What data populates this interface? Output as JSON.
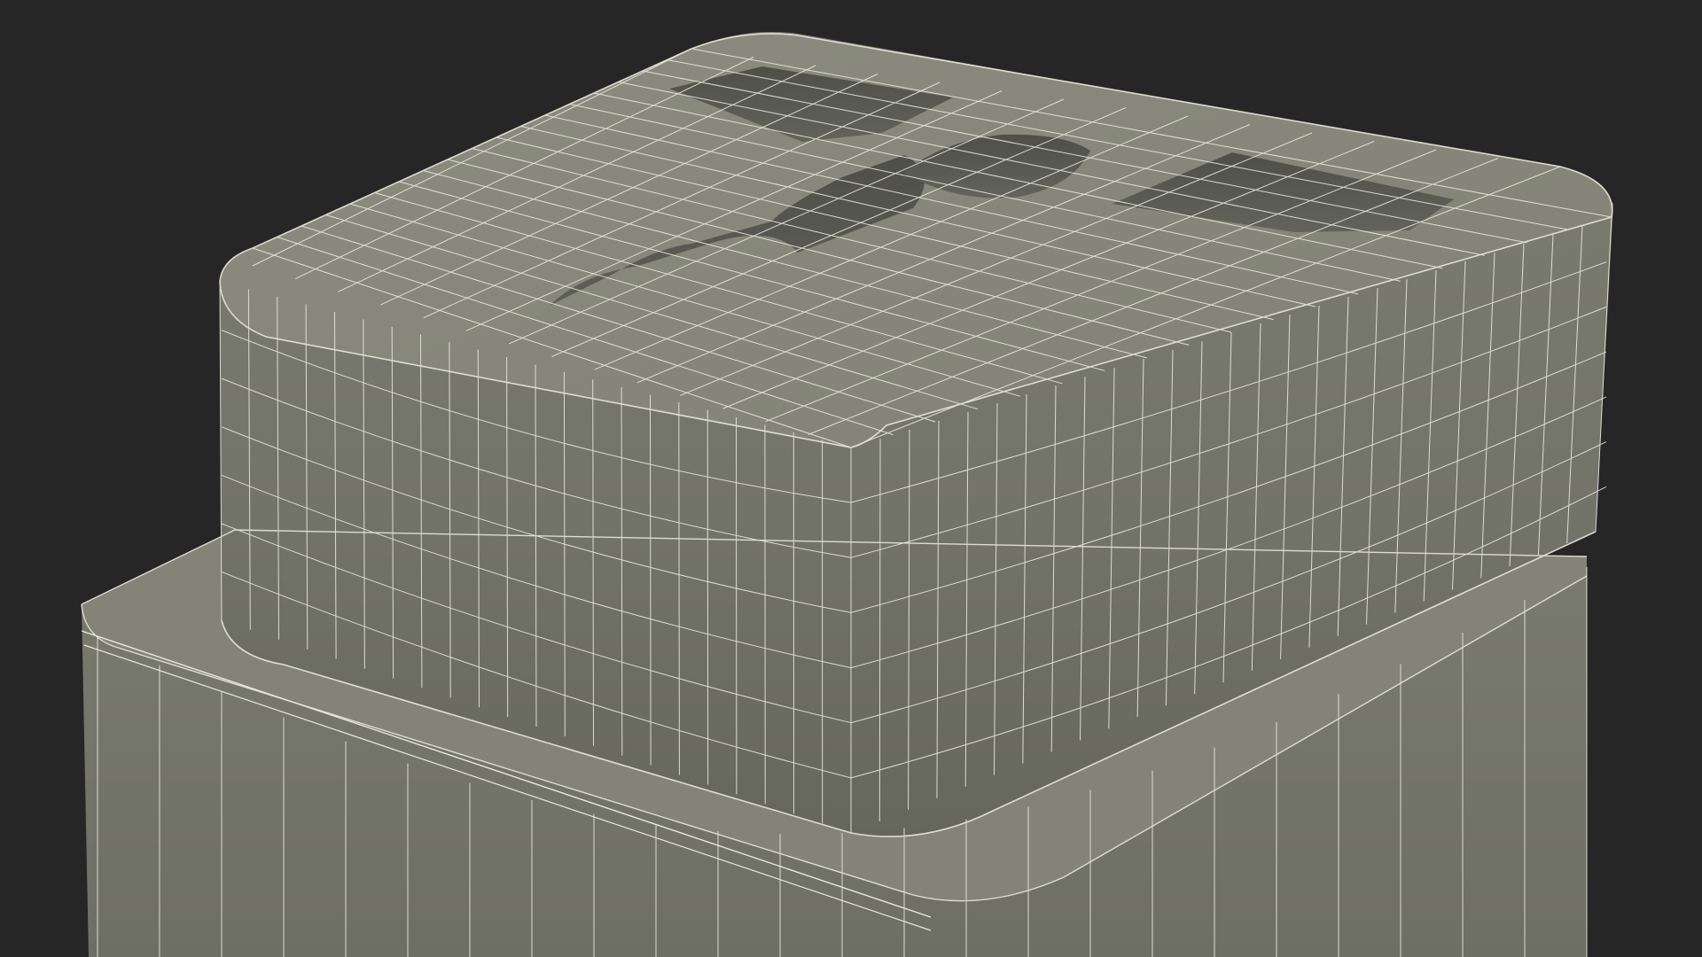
{
  "scene": {
    "subject": "wireframe-render",
    "icon": "3d-model-render",
    "colors": {
      "background": "#262626",
      "surface_top": "#8a8b7d",
      "surface_side": "#7a7b6e",
      "surface_dark": "#5f605a",
      "cavity": "#5a5b52",
      "wire": "#e8e8dc"
    }
  }
}
